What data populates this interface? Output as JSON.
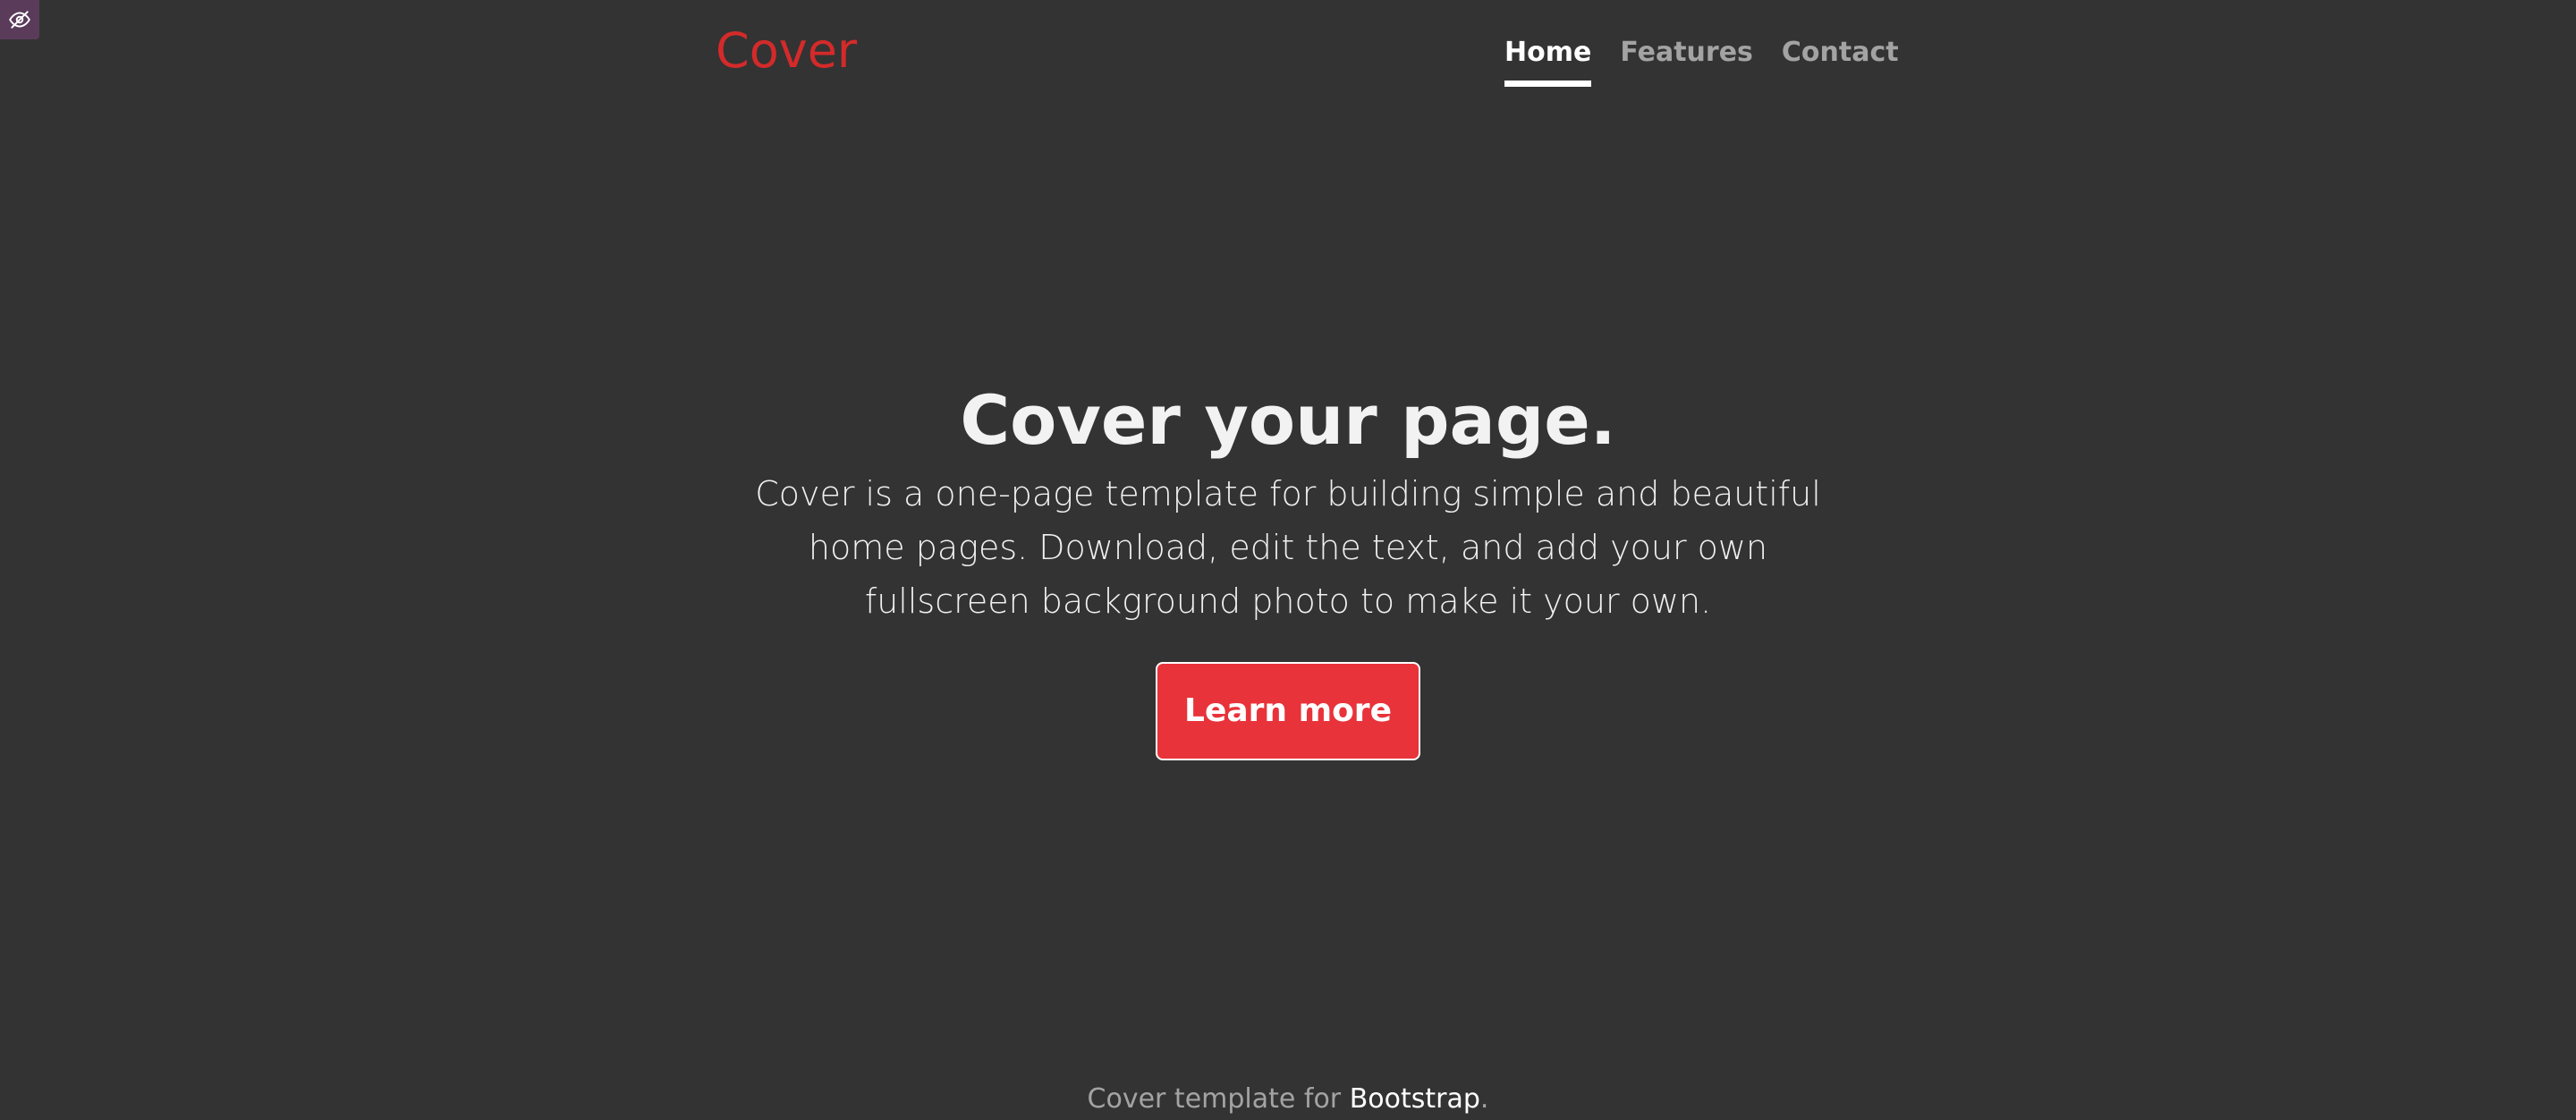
{
  "corner_badge": {
    "icon": "eye-slash-icon",
    "color": "#5a3b5a"
  },
  "header": {
    "brand": "Cover",
    "brand_color": "#d42a2a",
    "nav": [
      {
        "label": "Home",
        "active": true
      },
      {
        "label": "Features",
        "active": false
      },
      {
        "label": "Contact",
        "active": false
      }
    ]
  },
  "hero": {
    "title": "Cover your page.",
    "text": "Cover is a one-page template for building simple and beautiful home pages. Download, edit the text, and add your own fullscreen background photo to make it your own.",
    "button_label": "Learn more",
    "button_color": "#e8333a"
  },
  "footer": {
    "prefix": "Cover template for ",
    "link_text": "Bootstrap",
    "suffix": "."
  },
  "colors": {
    "background": "#333333",
    "text": "#f2f2f2"
  }
}
